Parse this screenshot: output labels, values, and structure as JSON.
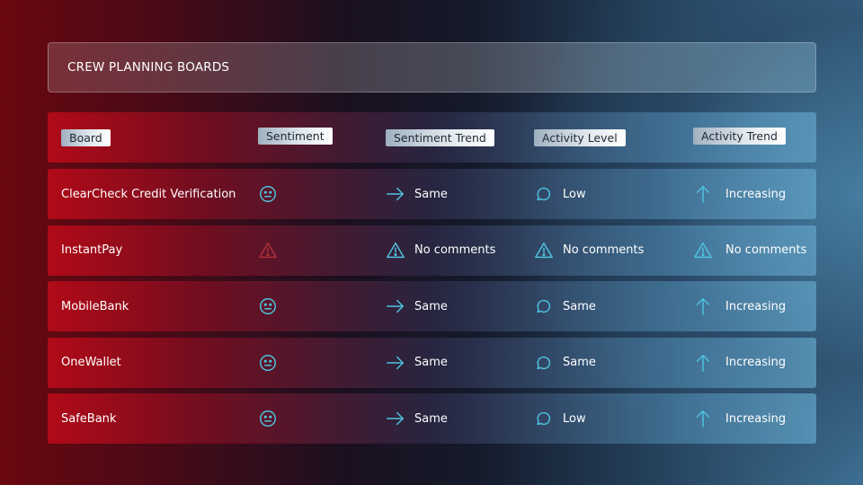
{
  "title": "CREW PLANNING BOARDS",
  "columns": [
    "Board",
    "Sentiment",
    "Sentiment Trend",
    "Activity Level",
    "Activity Trend"
  ],
  "colors": {
    "icon": "#4fc3e0",
    "warning_dim": "#b0303a"
  },
  "rows": [
    {
      "board": "ClearCheck Credit Verification",
      "sentiment_icon": "neutral-face",
      "sentiment_trend": "Same",
      "sentiment_trend_icon": "arrow-right",
      "activity_level": "Low",
      "activity_level_icon": "speech-bubble",
      "activity_trend": "Increasing",
      "activity_trend_icon": "arrow-up"
    },
    {
      "board": "InstantPay",
      "sentiment_icon": "warning",
      "sentiment_trend": "No comments",
      "sentiment_trend_icon": "warning",
      "activity_level": "No comments",
      "activity_level_icon": "warning",
      "activity_trend": "No comments",
      "activity_trend_icon": "warning"
    },
    {
      "board": "MobileBank",
      "sentiment_icon": "neutral-face",
      "sentiment_trend": "Same",
      "sentiment_trend_icon": "arrow-right",
      "activity_level": "Same",
      "activity_level_icon": "speech-bubble",
      "activity_trend": "Increasing",
      "activity_trend_icon": "arrow-up"
    },
    {
      "board": "OneWallet",
      "sentiment_icon": "neutral-face",
      "sentiment_trend": "Same",
      "sentiment_trend_icon": "arrow-right",
      "activity_level": "Same",
      "activity_level_icon": "speech-bubble",
      "activity_trend": "Increasing",
      "activity_trend_icon": "arrow-up"
    },
    {
      "board": "SafeBank",
      "sentiment_icon": "neutral-face",
      "sentiment_trend": "Same",
      "sentiment_trend_icon": "arrow-right",
      "activity_level": "Low",
      "activity_level_icon": "speech-bubble",
      "activity_trend": "Increasing",
      "activity_trend_icon": "arrow-up"
    }
  ]
}
